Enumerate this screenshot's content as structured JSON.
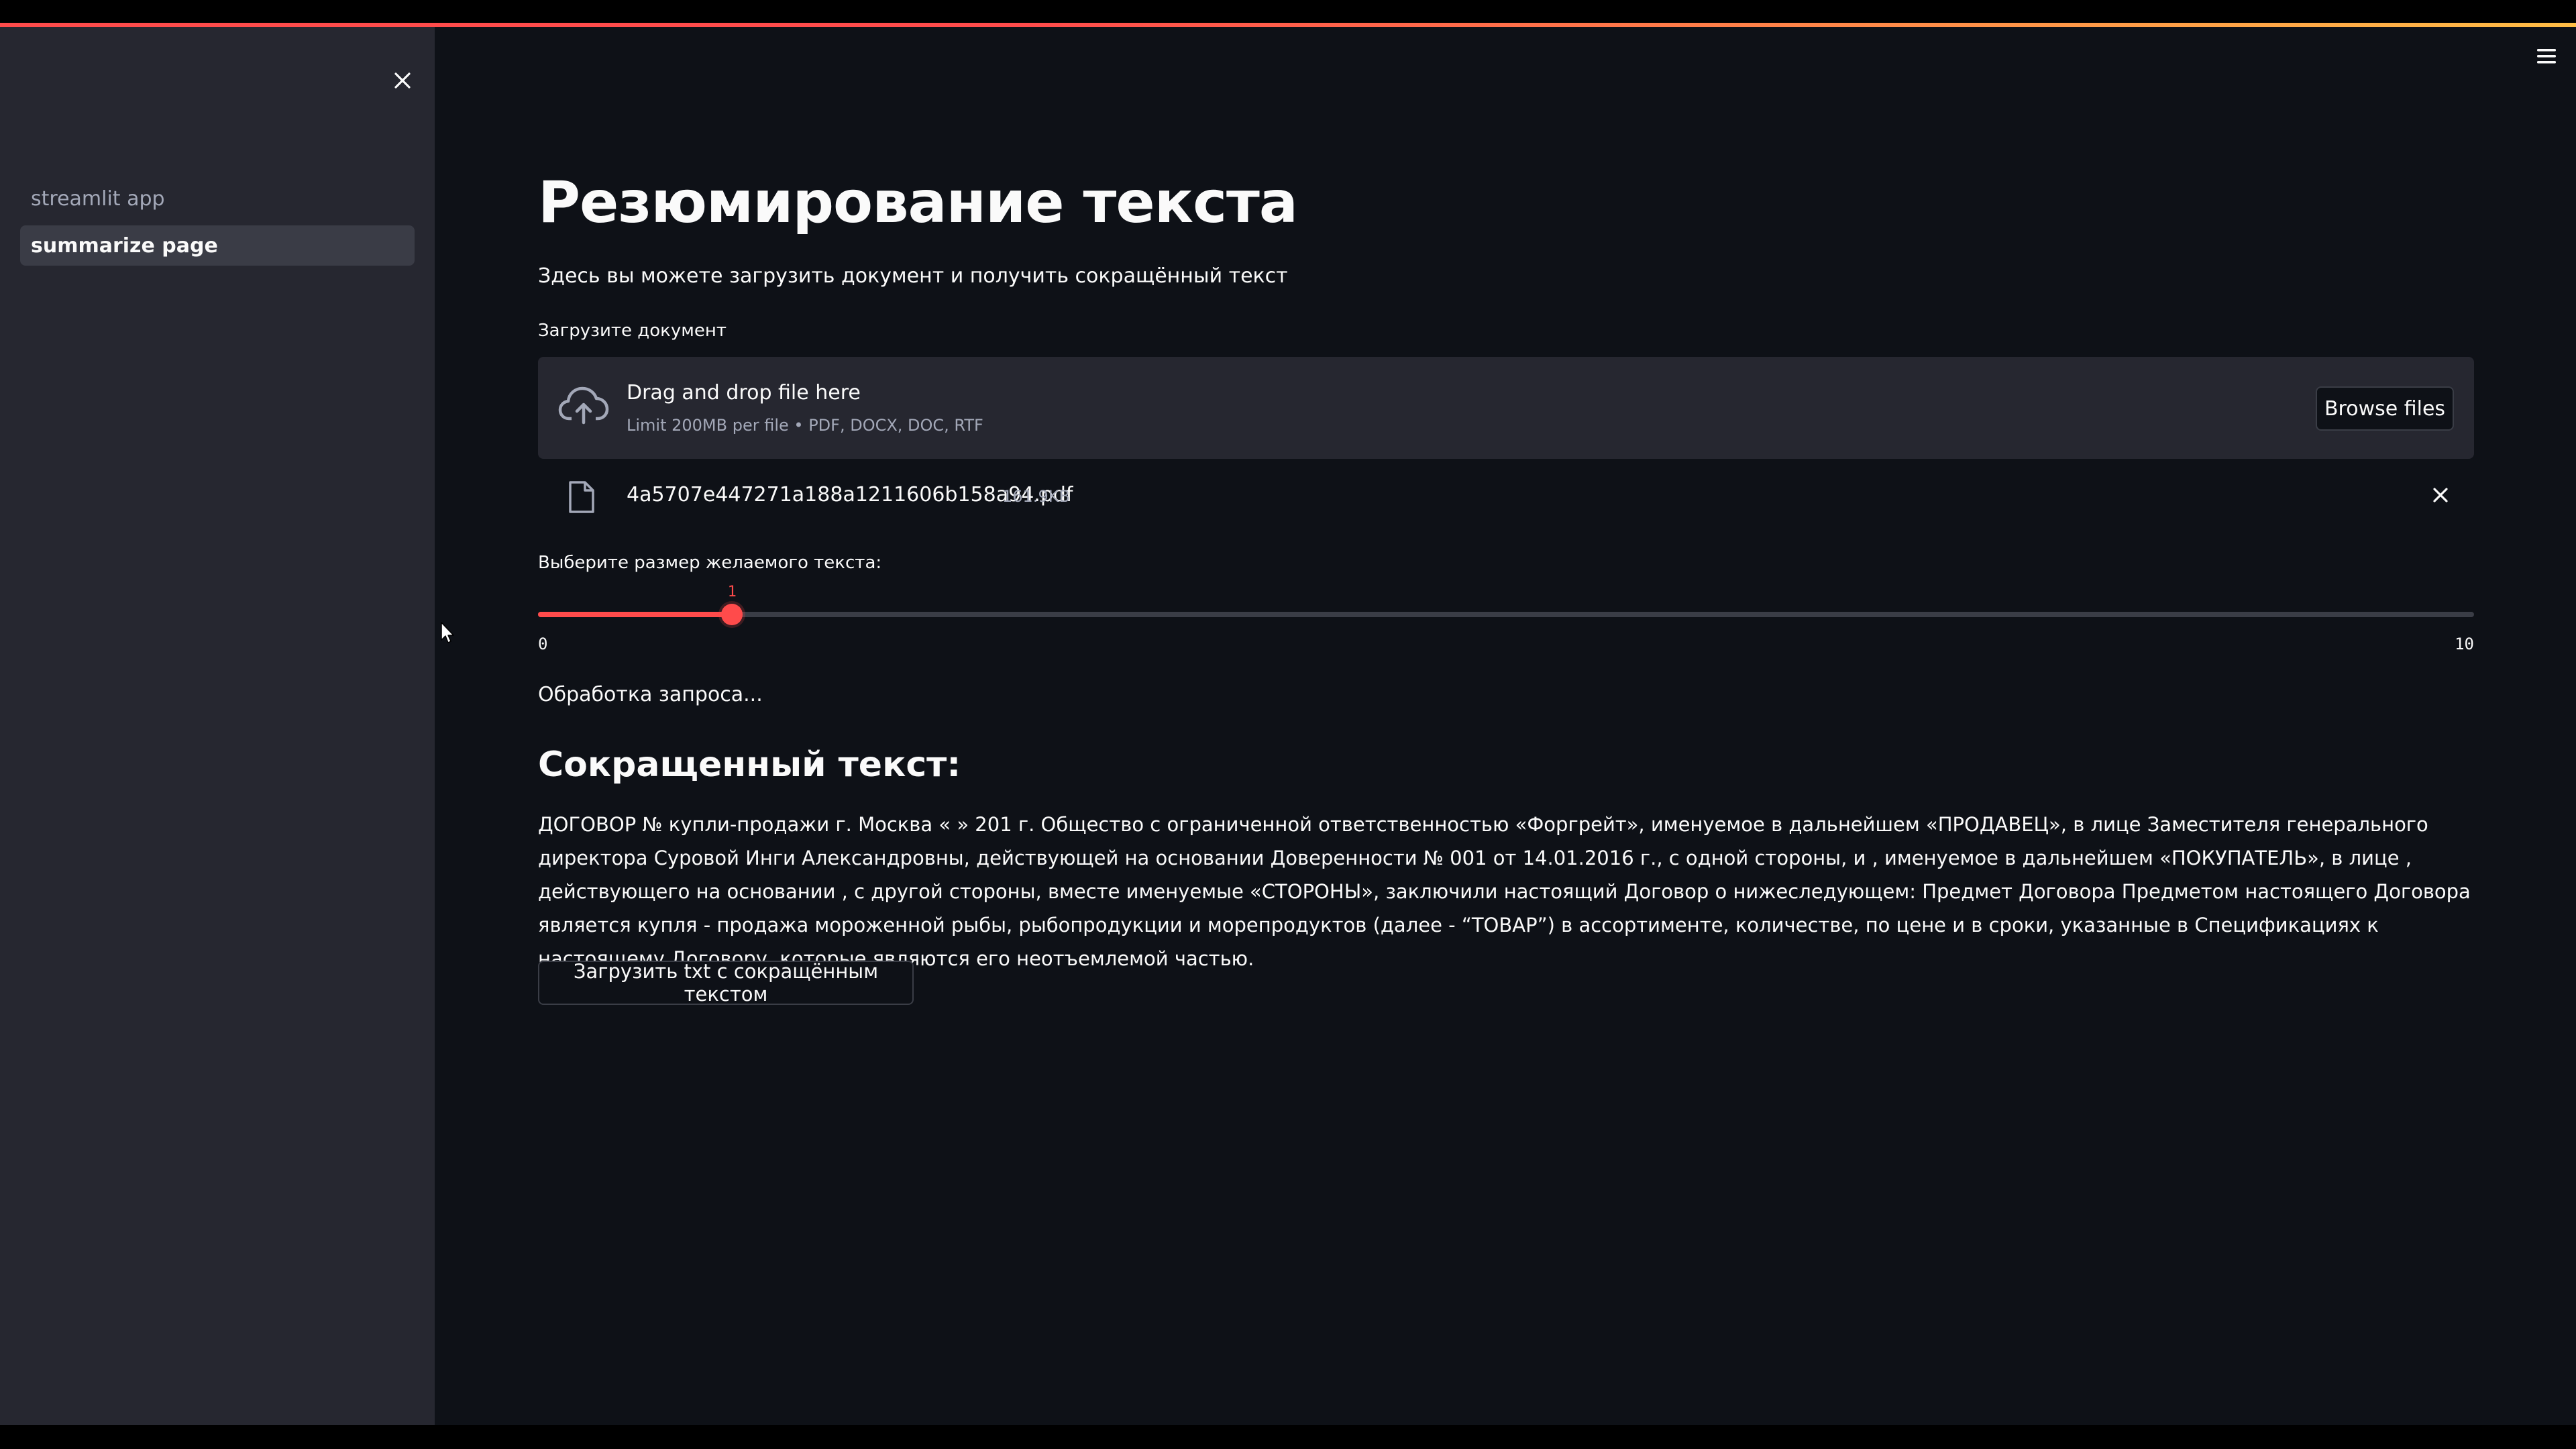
{
  "theme": {
    "background": "#0e1117",
    "sidebar_bg": "#262730",
    "accent": "#ff4b4b",
    "text": "#fafafa",
    "muted": "#a3a8b8"
  },
  "sidebar": {
    "items": [
      {
        "label": "streamlit app",
        "active": false
      },
      {
        "label": "summarize page",
        "active": true
      }
    ],
    "close_icon": "close-icon"
  },
  "header": {
    "menu_icon": "hamburger-menu-icon"
  },
  "main": {
    "title": "Резюмирование текста",
    "subtitle": "Здесь вы можете загрузить документ и получить сокращённый текст",
    "uploader": {
      "label": "Загрузите документ",
      "drop_title": "Drag and drop file here",
      "limit_text": "Limit 200MB per file • PDF, DOCX, DOC, RTF",
      "browse_label": "Browse files",
      "icon": "cloud-upload-icon"
    },
    "uploaded_file": {
      "name": "4a5707e447271a188a1211606b158a94.pdf",
      "size": "161.9KB",
      "icon": "file-icon"
    },
    "slider": {
      "label": "Выберите размер желаемого текста:",
      "value": 1,
      "min": 0,
      "max": 10,
      "value_text": "1",
      "min_text": "0",
      "max_text": "10"
    },
    "status_text": "Обработка запроса...",
    "result_heading": "Сокращенный текст:",
    "result_text": "ДОГОВОР № купли-продажи г. Москва « » 201 г. Общество с ограниченной ответственностью «Форгрейт», именуемое в дальнейшем «ПРОДАВЕЦ», в лице Заместителя генерального директора Суровой Инги Александровны, действующей на основании Доверенности № 001 от 14.01.2016 г., с одной стороны, и , именуемое в дальнейшем «ПОКУПАТЕЛЬ», в лице , действующего на основании , с другой стороны, вместе именуемые «СТОРОНЫ», заключили настоящий Договор о нижеследующем: Предмет Договора Предметом настоящего Договора является купля - продажа мороженной рыбы, рыбопродукции и морепродуктов (далее - “ТОВАР”) в ассортименте, количестве, по цене и в сроки, указанные в Спецификациях к настоящему Договору, которые являются его неотъемлемой частью.",
    "download_label": "Загрузить txt с сокращённым текстом"
  }
}
